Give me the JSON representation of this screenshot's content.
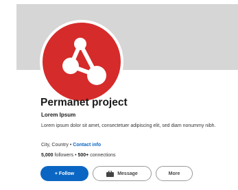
{
  "profile": {
    "name": "Permanet project",
    "headline": "Lorem Ipsum",
    "description": "Lorem ipsum dolor sit amet, consectetuer adipiscing elit, sed diam nonummy nibh.",
    "location": "City, Country",
    "separator": "•",
    "contact_label": "Contact info",
    "followers_count": "5,000",
    "followers_label": "followers",
    "connections_count": "500+",
    "connections_label": "connections"
  },
  "actions": {
    "follow_label": "+ Follow",
    "message_label": "Message",
    "more_label": "More"
  },
  "icons": {
    "avatar_logo": "network-molecule-icon",
    "message": "briefcase-icon"
  },
  "colors": {
    "brand_red": "#d62b2b",
    "accent_blue": "#0a66c2",
    "cover_gray": "#d6d6d6"
  }
}
